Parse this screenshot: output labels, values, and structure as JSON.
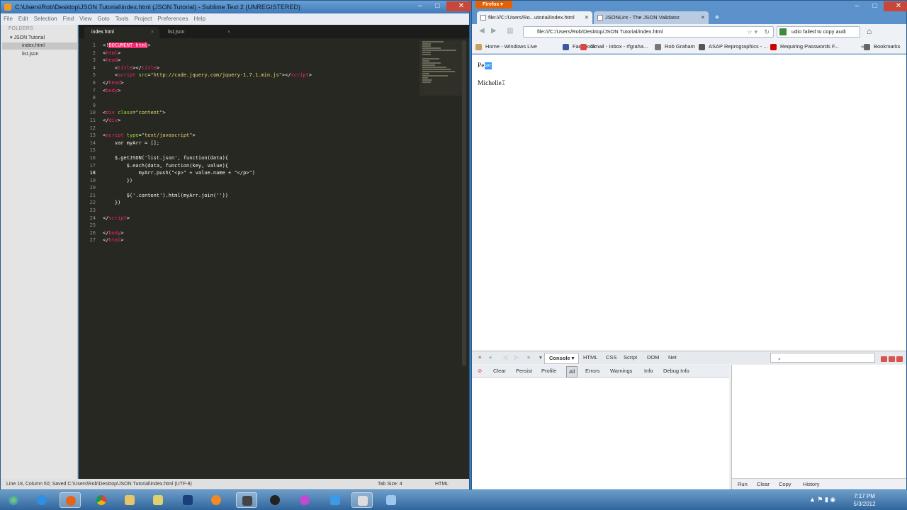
{
  "sublime": {
    "title": "C:\\Users\\Rob\\Desktop\\JSON Tutorial\\index.html (JSON Tutorial) - Sublime Text 2 (UNREGISTERED)",
    "menu": [
      "File",
      "Edit",
      "Selection",
      "Find",
      "View",
      "Goto",
      "Tools",
      "Project",
      "Preferences",
      "Help"
    ],
    "sidebar": {
      "header": "FOLDERS",
      "folder": "JSON Tutorial",
      "files": [
        "index.html",
        "list.json"
      ]
    },
    "tabs": [
      {
        "label": "index.html"
      },
      {
        "label": "list.json"
      }
    ],
    "line_numbers": [
      "1",
      "2",
      "3",
      "4",
      "5",
      "6",
      "7",
      "8",
      "9",
      "10",
      "11",
      "12",
      "13",
      "14",
      "15",
      "16",
      "17",
      "18",
      "19",
      "20",
      "21",
      "22",
      "23",
      "24",
      "25",
      "26",
      "27"
    ],
    "code": {
      "l1_doctype": "DOCUMENT html",
      "l4_title": "title",
      "l5_src": "\"http://code.jquery.com/jquery-1.7.1.min.js\"",
      "l10_class": "\"content\"",
      "l13_type": "\"text/javascript\"",
      "l14_decl": "var myArr = [];",
      "l16_call": "$.getJSON('list.json', function(data){",
      "l17_each": "$.each(data, function(key, value){",
      "l18_push": "myArr.push(\"<p>\" + value.name + \"</p>\")",
      "l19_close": "})",
      "l21_html": "$('.content').html(myArr.join(''))",
      "l22_close": "})"
    },
    "status": {
      "left": "Line 18, Column 50; Saved C:\\Users\\Rob\\Desktop\\JSON Tutorial\\index.html (UTF-8)",
      "tab_size": "Tab Size: 4",
      "syntax": "HTML"
    }
  },
  "firefox": {
    "button": "Firefox",
    "tabs": [
      "file:///C:/Users/Ro...utorial/index.html",
      "JSONLint - The JSON Validator."
    ],
    "url": "file:///C:/Users/Rob/Desktop/JSON Tutorial/index.html",
    "search": "udio failed to copy audi",
    "bookmarks": [
      "Home - Windows Live",
      "Facebook",
      "Gmail - Inbox - rfgraha...",
      "Rob Graham",
      "ASAP Reprographics - ...",
      "Requiring Passwords F..."
    ],
    "bookmarks_menu": "Bookmarks",
    "page": {
      "line1_plain": "Pe",
      "line1_selected": "ter",
      "line2": "Michelle"
    },
    "firebug": {
      "panels": [
        "Console",
        "HTML",
        "CSS",
        "Script",
        "DOM",
        "Net"
      ],
      "filters": [
        "Clear",
        "Persist",
        "Profile",
        "All",
        "Errors",
        "Warnings",
        "Info",
        "Debug Info"
      ],
      "cmd_buttons": [
        "Run",
        "Clear",
        "Copy",
        "History"
      ]
    }
  },
  "taskbar": {
    "time": "7:17 PM",
    "date": "5/3/2012"
  }
}
